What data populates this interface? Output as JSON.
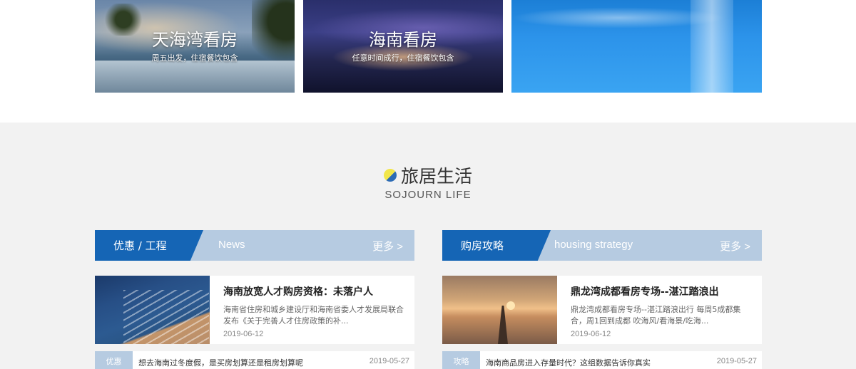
{
  "banners": [
    {
      "title": "天海湾看房",
      "subtitle": "周五出发，住宿餐饮包含"
    },
    {
      "title": "海南看房",
      "subtitle": "任意时间成行，住宿餐饮包含"
    },
    {
      "title": "",
      "subtitle": ""
    }
  ],
  "section": {
    "title": "旅居生活",
    "subtitle": "SOJOURN LIFE"
  },
  "columns": [
    {
      "tab_label": "优惠 / 工程",
      "english_label": "News",
      "more_label": "更多 >",
      "feature": {
        "title": "海南放宽人才购房资格：未落户人",
        "description": "海南省住房和城乡建设厅和海南省委人才发展局联合发布《关于完善人才住房政策的补...",
        "date": "2019-06-12"
      },
      "row": {
        "tag": "优惠",
        "text": "想去海南过冬度假，是买房划算还是租房划算呢",
        "date": "2019-05-27"
      }
    },
    {
      "tab_label": "购房攻略",
      "english_label": "housing strategy",
      "more_label": "更多 >",
      "feature": {
        "title": "鼎龙湾成都看房专场--湛江踏浪出",
        "description": "鼎龙湾成都看房专场--湛江踏浪出行 每周5成都集合，周1回到成都 吹海风/看海景/吃海...",
        "date": "2019-06-12"
      },
      "row": {
        "tag": "攻略",
        "text": "海南商品房进入存量时代？这组数据告诉你真实",
        "date": "2019-05-27"
      }
    }
  ]
}
